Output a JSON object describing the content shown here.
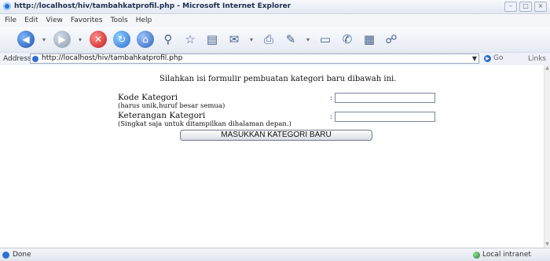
{
  "window": {
    "title": "http://localhost/hiv/tambahkatprofil.php - Microsoft Internet Explorer"
  },
  "menu": [
    "File",
    "Edit",
    "View",
    "Favorites",
    "Tools",
    "Help"
  ],
  "address": {
    "label": "Address",
    "url": "http://localhost/hiv/tambahkatprofil.php",
    "go": "Go",
    "links": "Links"
  },
  "form": {
    "intro": "Silahkan isi formulir pembuatan kategori baru dibawah ini.",
    "kode_label": "Kode Kategori",
    "kode_hint": "(harus unik,huruf besar semua)",
    "ket_label": "Keterangan Kategori",
    "ket_hint": "(Singkat saja untuk ditampilkan dihalaman depan.)",
    "colon": ":",
    "kode_value": "",
    "ket_value": "",
    "submit": "MASUKKAN KATEGORI BARU"
  },
  "status": {
    "text": "Done",
    "zone": "Local intranet"
  }
}
